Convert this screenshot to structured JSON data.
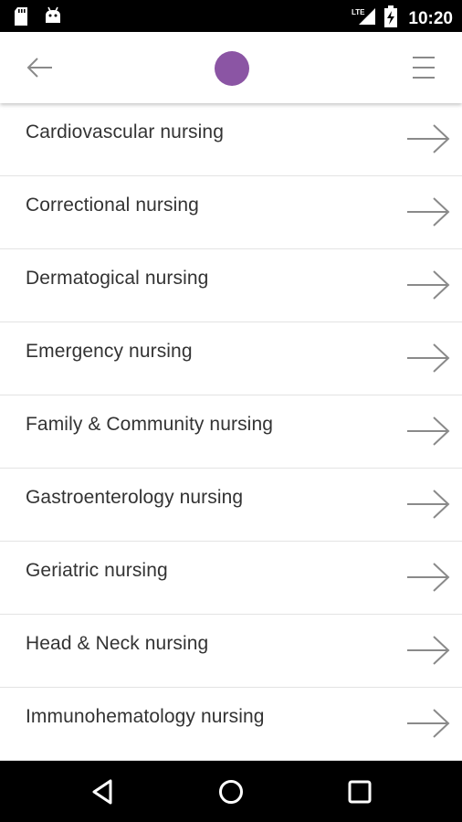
{
  "status_bar": {
    "time": "10:20",
    "network_label": "LTE",
    "icons": [
      "sd-card-icon",
      "android-debug-icon",
      "lte-signal-icon",
      "battery-charging-icon"
    ]
  },
  "app_bar": {
    "back_icon": "arrow-left-icon",
    "logo_color": "#8b55a4",
    "menu_icon": "hamburger-menu-icon"
  },
  "list": {
    "items": [
      {
        "label": "Cardiovascular nursing"
      },
      {
        "label": "Correctional nursing"
      },
      {
        "label": "Dermatogical nursing"
      },
      {
        "label": "Emergency nursing"
      },
      {
        "label": "Family & Community nursing"
      },
      {
        "label": "Gastroenterology nursing"
      },
      {
        "label": "Geriatric nursing"
      },
      {
        "label": "Head & Neck nursing"
      },
      {
        "label": "Immunohematology nursing"
      }
    ],
    "arrow_icon": "arrow-right-icon"
  },
  "nav_bar": {
    "icons": [
      "back-triangle-icon",
      "home-circle-icon",
      "recents-square-icon"
    ]
  },
  "colors": {
    "accent": "#8b55a4",
    "text": "#333333",
    "divider": "#e3e3e3",
    "arrow": "#8a8a8a"
  }
}
